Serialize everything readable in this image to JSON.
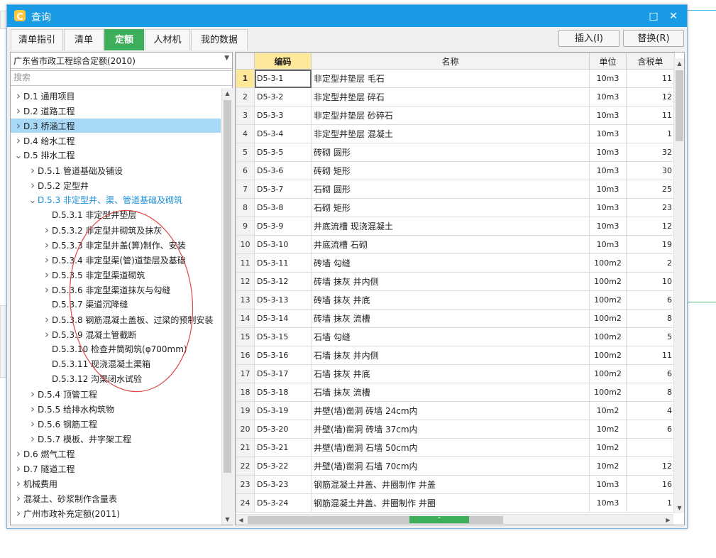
{
  "window": {
    "title": "查询"
  },
  "tabs": [
    {
      "label": "清单指引",
      "active": false
    },
    {
      "label": "清单",
      "active": false
    },
    {
      "label": "定额",
      "active": true
    },
    {
      "label": "人材机",
      "active": false
    },
    {
      "label": "我的数据",
      "active": false
    }
  ],
  "toolbar": {
    "insert_label": "插入(I)",
    "replace_label": "替换(R)"
  },
  "left": {
    "library": "广东省市政工程综合定额(2010)",
    "search_placeholder": "搜索",
    "tree": [
      {
        "label": "D.1 通用项目",
        "level": 0,
        "toggle": "right"
      },
      {
        "label": "D.2 道路工程",
        "level": 0,
        "toggle": "right"
      },
      {
        "label": "D.3 桥涵工程",
        "level": 0,
        "toggle": "right",
        "selected": true
      },
      {
        "label": "D.4 给水工程",
        "level": 0,
        "toggle": "right"
      },
      {
        "label": "D.5 排水工程",
        "level": 0,
        "toggle": "down"
      },
      {
        "label": "D.5.1 管道基础及铺设",
        "level": 1,
        "toggle": "right"
      },
      {
        "label": "D.5.2 定型井",
        "level": 1,
        "toggle": "right"
      },
      {
        "label": "D.5.3 非定型井、渠、管道基础及砌筑",
        "level": 1,
        "toggle": "down",
        "active": true
      },
      {
        "label": "D.5.3.1 非定型井垫层",
        "level": 2,
        "toggle": ""
      },
      {
        "label": "D.5.3.2 非定型井砌筑及抹灰",
        "level": 2,
        "toggle": "right"
      },
      {
        "label": "D.5.3.3 非定型井盖(箅)制作、安装",
        "level": 2,
        "toggle": "right"
      },
      {
        "label": "D.5.3.4 非定型渠(管)道垫层及基础",
        "level": 2,
        "toggle": "right"
      },
      {
        "label": "D.5.3.5 非定型渠道砌筑",
        "level": 2,
        "toggle": "right"
      },
      {
        "label": "D.5.3.6 非定型渠道抹灰与勾缝",
        "level": 2,
        "toggle": "right"
      },
      {
        "label": "D.5.3.7 渠道沉降缝",
        "level": 2,
        "toggle": ""
      },
      {
        "label": "D.5.3.8 钢筋混凝土盖板、过梁的预制安装",
        "level": 2,
        "toggle": "right"
      },
      {
        "label": "D.5.3.9 混凝土管截断",
        "level": 2,
        "toggle": "right"
      },
      {
        "label": "D.5.3.10 检查井筒砌筑(φ700mm)",
        "level": 2,
        "toggle": ""
      },
      {
        "label": "D.5.3.11 现浇混凝土渠箱",
        "level": 2,
        "toggle": ""
      },
      {
        "label": "D.5.3.12 沟渠闭水试验",
        "level": 2,
        "toggle": ""
      },
      {
        "label": "D.5.4 顶管工程",
        "level": 1,
        "toggle": "right"
      },
      {
        "label": "D.5.5 给排水构筑物",
        "level": 1,
        "toggle": "right"
      },
      {
        "label": "D.5.6 钢筋工程",
        "level": 1,
        "toggle": "right"
      },
      {
        "label": "D.5.7 模板、井字架工程",
        "level": 1,
        "toggle": "right"
      },
      {
        "label": "D.6 燃气工程",
        "level": 0,
        "toggle": "right"
      },
      {
        "label": "D.7 隧道工程",
        "level": 0,
        "toggle": "right"
      },
      {
        "label": "机械费用",
        "level": 0,
        "toggle": "right"
      },
      {
        "label": "混凝土、砂浆制作含量表",
        "level": 0,
        "toggle": "right"
      },
      {
        "label": "广州市政补充定额(2011)",
        "level": 0,
        "toggle": "right"
      }
    ]
  },
  "grid": {
    "headers": {
      "code": "编码",
      "name": "名称",
      "unit": "单位",
      "price": "含税单"
    },
    "rows": [
      {
        "n": "1",
        "code": "D5-3-1",
        "name": "非定型井垫层 毛石",
        "unit": "10m3",
        "price": "11"
      },
      {
        "n": "2",
        "code": "D5-3-2",
        "name": "非定型井垫层 碎石",
        "unit": "10m3",
        "price": "12"
      },
      {
        "n": "3",
        "code": "D5-3-3",
        "name": "非定型井垫层 砂碎石",
        "unit": "10m3",
        "price": "11"
      },
      {
        "n": "4",
        "code": "D5-3-4",
        "name": "非定型井垫层 混凝土",
        "unit": "10m3",
        "price": "1"
      },
      {
        "n": "5",
        "code": "D5-3-5",
        "name": "砖砌 圆形",
        "unit": "10m3",
        "price": "32"
      },
      {
        "n": "6",
        "code": "D5-3-6",
        "name": "砖砌 矩形",
        "unit": "10m3",
        "price": "30"
      },
      {
        "n": "7",
        "code": "D5-3-7",
        "name": "石砌 圆形",
        "unit": "10m3",
        "price": "25"
      },
      {
        "n": "8",
        "code": "D5-3-8",
        "name": "石砌 矩形",
        "unit": "10m3",
        "price": "23"
      },
      {
        "n": "9",
        "code": "D5-3-9",
        "name": "井底流槽 现浇混凝土",
        "unit": "10m3",
        "price": "12"
      },
      {
        "n": "10",
        "code": "D5-3-10",
        "name": "井底流槽 石砌",
        "unit": "10m3",
        "price": "19"
      },
      {
        "n": "11",
        "code": "D5-3-11",
        "name": "砖墙 勾缝",
        "unit": "100m2",
        "price": "2"
      },
      {
        "n": "12",
        "code": "D5-3-12",
        "name": "砖墙 抹灰 井内侧",
        "unit": "100m2",
        "price": "10"
      },
      {
        "n": "13",
        "code": "D5-3-13",
        "name": "砖墙 抹灰 井底",
        "unit": "100m2",
        "price": "6"
      },
      {
        "n": "14",
        "code": "D5-3-14",
        "name": "砖墙 抹灰 流槽",
        "unit": "100m2",
        "price": "8"
      },
      {
        "n": "15",
        "code": "D5-3-15",
        "name": "石墙 勾缝",
        "unit": "100m2",
        "price": "5"
      },
      {
        "n": "16",
        "code": "D5-3-16",
        "name": "石墙 抹灰 井内侧",
        "unit": "100m2",
        "price": "11"
      },
      {
        "n": "17",
        "code": "D5-3-17",
        "name": "石墙 抹灰 井底",
        "unit": "100m2",
        "price": "6"
      },
      {
        "n": "18",
        "code": "D5-3-18",
        "name": "石墙 抹灰 流槽",
        "unit": "100m2",
        "price": "8"
      },
      {
        "n": "19",
        "code": "D5-3-19",
        "name": "井壁(墙)凿洞 砖墙 24cm内",
        "unit": "10m2",
        "price": "4"
      },
      {
        "n": "20",
        "code": "D5-3-20",
        "name": "井壁(墙)凿洞 砖墙 37cm内",
        "unit": "10m2",
        "price": "6"
      },
      {
        "n": "21",
        "code": "D5-3-21",
        "name": "井壁(墙)凿洞 石墙 50cm内",
        "unit": "10m2",
        "price": ""
      },
      {
        "n": "22",
        "code": "D5-3-22",
        "name": "井壁(墙)凿洞 石墙 70cm内",
        "unit": "10m2",
        "price": "12"
      },
      {
        "n": "23",
        "code": "D5-3-23",
        "name": "钢筋混凝土井盖、井圈制作 井盖",
        "unit": "10m3",
        "price": "16"
      },
      {
        "n": "24",
        "code": "D5-3-24",
        "name": "钢筋混凝土井盖、井圈制作 井圈",
        "unit": "10m3",
        "price": "1"
      }
    ]
  },
  "colors": {
    "titlebar": "#1a9be6",
    "active_tab": "#3daf5a",
    "selection": "#a8d8f8",
    "header_highlight": "#ffe89a",
    "annotation": "#e04848"
  }
}
